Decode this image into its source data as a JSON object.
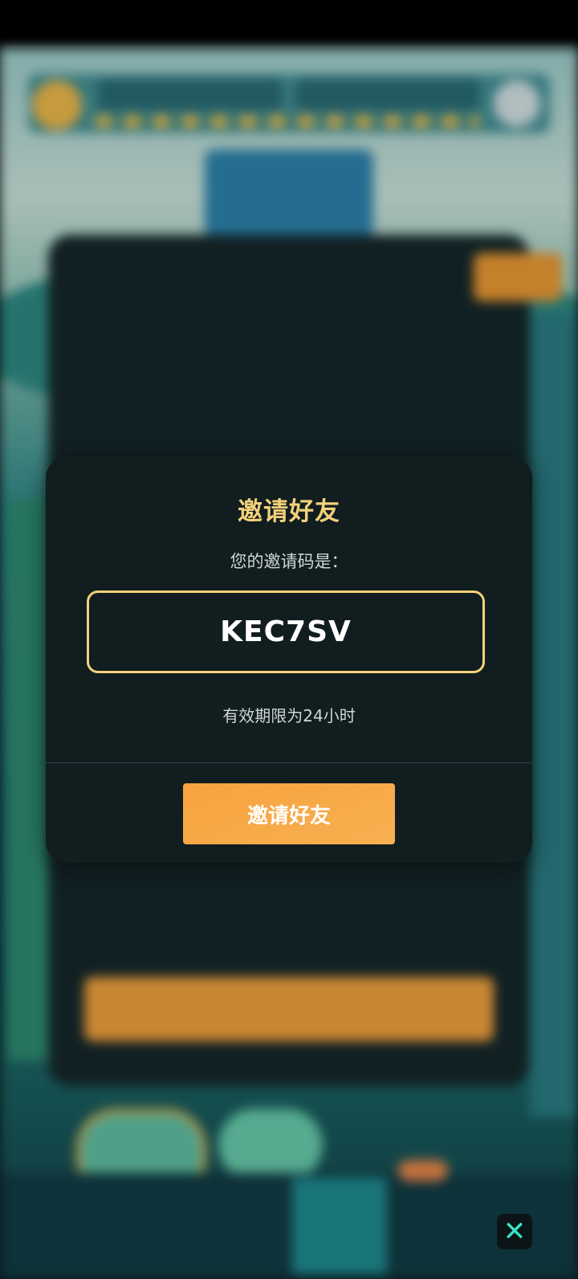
{
  "dialog": {
    "title": "邀请好友",
    "subtitle": "您的邀请码是：",
    "invite_code": "KEC7SV",
    "validity": "有效期限为24小时",
    "button_label": "邀请好友"
  },
  "close": {
    "icon": "close-icon",
    "glyph": "✕"
  },
  "colors": {
    "accent_gold": "#f3d17a",
    "button_orange": "#f6a33e",
    "dialog_bg": "#111d1f",
    "close_icon": "#39e6c9"
  }
}
